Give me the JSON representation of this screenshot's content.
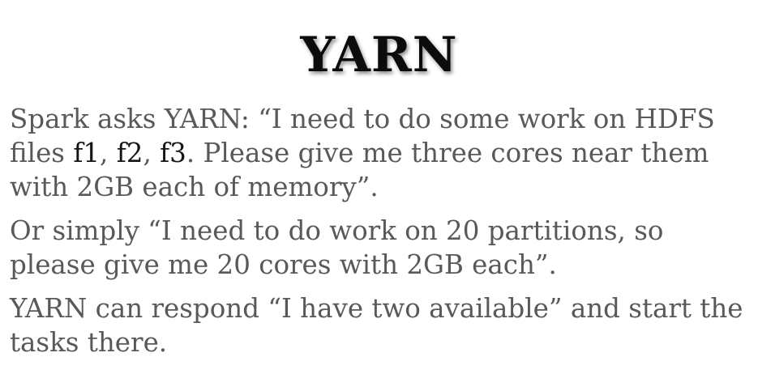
{
  "slide": {
    "title": "YARN",
    "paragraph1": {
      "text_before": "Spark asks YARN: “I need to do some work on HDFS files ",
      "file1": "f1",
      "sep1": ", ",
      "file2": "f2",
      "sep2": ", ",
      "file3": "f3",
      "text_after": ". Please give me three cores near them with 2GB each of memory”."
    },
    "paragraph2": "Or simply “I need to do work on 20 partitions, so please give me 20 cores with 2GB each”.",
    "paragraph3": "YARN can respond “I have two available” and start the tasks there."
  },
  "colors": {
    "title": "#0c0c0c",
    "body_text": "#595959",
    "file_names": "#151515",
    "background": "#ffffff"
  }
}
